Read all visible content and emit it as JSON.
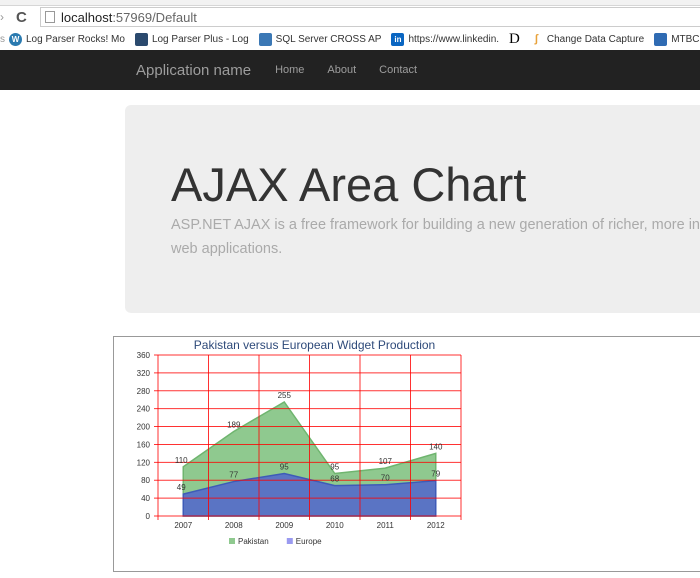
{
  "browser": {
    "url_host": "localhost",
    "url_rest": ":57969/Default",
    "bookmarks": [
      {
        "label": "Log Parser Rocks! Mo",
        "icon": "wordpress-icon",
        "color": "#2a7ab0"
      },
      {
        "label": "Log Parser Plus - Log",
        "icon": "logparser-icon",
        "color": "#2b4a6e"
      },
      {
        "label": "SQL Server CROSS AP",
        "icon": "sqlserver-icon",
        "color": "#3b78b5"
      },
      {
        "label": "https://www.linkedin.",
        "icon": "linkedin-icon",
        "color": "#0a66c2"
      },
      {
        "label": "",
        "icon": "d-icon",
        "color": "#000"
      },
      {
        "label": "Change Data Capture",
        "icon": "cdc-icon",
        "color": "#e8a23a"
      },
      {
        "label": "MTBC Membe",
        "icon": "mtbc-icon",
        "color": "#2f6bb3"
      }
    ]
  },
  "navbar": {
    "brand": "Application name",
    "links": [
      "Home",
      "About",
      "Contact"
    ]
  },
  "jumbotron": {
    "title": "AJAX Area Chart",
    "line1": "ASP.NET AJAX is a free framework for building a new generation of richer, more in",
    "line2": "web applications."
  },
  "chart_data": {
    "type": "area",
    "title": "Pakistan versus European Widget Production",
    "categories": [
      "2007",
      "2008",
      "2009",
      "2010",
      "2011",
      "2012"
    ],
    "ylim": [
      0,
      360
    ],
    "ytick_step": 40,
    "grid": true,
    "grid_color": "#ff0000",
    "legend": "bottom-left",
    "series": [
      {
        "name": "Pakistan",
        "values": [
          110,
          189,
          255,
          95,
          107,
          140
        ],
        "color": "#8fc98f",
        "line": "#6fb56f"
      },
      {
        "name": "Europe",
        "values": [
          49,
          77,
          95,
          68,
          70,
          79
        ],
        "color": "#5a74c4",
        "line": "#3e5bb8"
      }
    ]
  }
}
